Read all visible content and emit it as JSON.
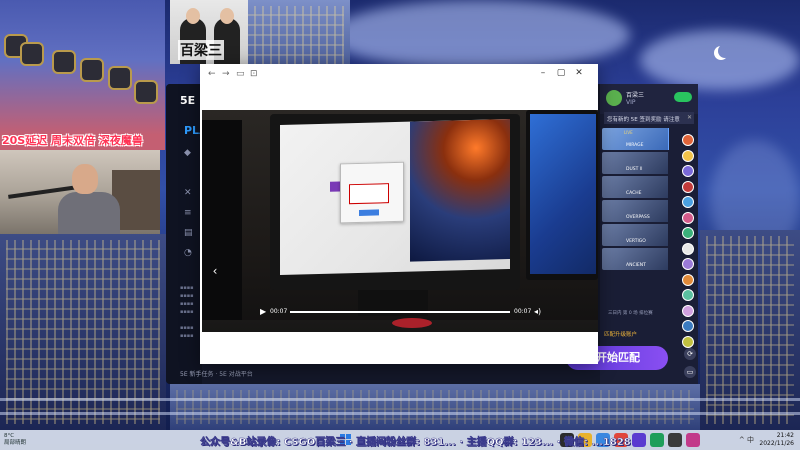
{
  "overlay": {
    "promo_text": "20S延迟 周末双倍 深夜魔兽",
    "poster_title": "百梁三",
    "marquee": "公众号&B站录像: CSGO百梁三 · 直播间粉丝群: 831... · 主播QQ群: 123... · 微信: ...1828"
  },
  "client": {
    "brand": "5E",
    "plan_label": "PLA",
    "footer_text": "5E 新手任务 · 5E 对战平台",
    "user": {
      "name": "百梁三",
      "sub": "VIP"
    },
    "notice": "您有新的 5E 签到奖励 请注意",
    "maps": [
      {
        "name": "MIRAGE",
        "tag": "LIVE",
        "selected": true
      },
      {
        "name": "DUST II",
        "tag": "",
        "selected": false
      },
      {
        "name": "CACHE",
        "tag": "",
        "selected": false
      },
      {
        "name": "OVERPASS",
        "tag": "",
        "selected": false
      },
      {
        "name": "VERTIGO",
        "tag": "",
        "selected": false
      },
      {
        "name": "ANCIENT",
        "tag": "",
        "selected": false
      }
    ],
    "map_caption": "三日内 第 0 场 排位赛",
    "rank_text": "匹配升级账户",
    "match_button": "开始匹配",
    "player_avatar_colors": [
      "#e0643a",
      "#f0c24a",
      "#7a6ad8",
      "#c23a3a",
      "#4aa0e0",
      "#d45a8a",
      "#3ab07a",
      "#e8e8e8",
      "#9a7ad8",
      "#e08a3a",
      "#5ac0a0",
      "#d0a0e0",
      "#3a7ac0",
      "#c0c040"
    ]
  },
  "viewer": {
    "current_time": "00:07",
    "total_time": "00:07",
    "progress": 1.0,
    "prev_label": "‹",
    "next_label": "›"
  },
  "taskbar": {
    "weather_temp": "8°C",
    "weather_desc": "局部晴朗",
    "time": "21:42",
    "date": "2022/11/26",
    "sys_label": "^ 中"
  }
}
